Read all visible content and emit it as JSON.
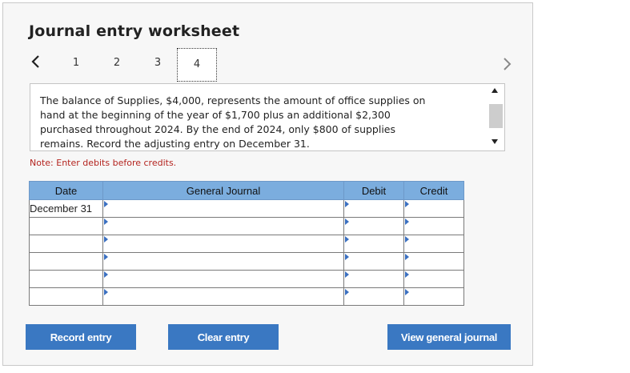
{
  "title": "Journal entry worksheet",
  "steps": [
    "1",
    "2",
    "3",
    "4"
  ],
  "active_step": "4",
  "prompt": "The balance of Supplies, $4,000, represents the amount of office supplies on hand at the beginning of the year of $1,700 plus an additional $2,300 purchased throughout 2024. By the end of 2024, only $800 of supplies remains. Record the adjusting entry on December 31.",
  "prompt_lines": [
    "The balance of Supplies, $4,000, represents the amount of office supplies on",
    "hand at the beginning of the year of $1,700 plus an additional $2,300",
    "purchased throughout 2024. By the end of 2024, only $800 of supplies",
    "remains. Record the adjusting entry on December 31."
  ],
  "note": "Note: Enter debits before credits.",
  "table": {
    "headers": {
      "date": "Date",
      "general_journal": "General Journal",
      "debit": "Debit",
      "credit": "Credit"
    },
    "rows": [
      {
        "date": "December 31"
      },
      {
        "date": ""
      },
      {
        "date": ""
      },
      {
        "date": ""
      },
      {
        "date": ""
      },
      {
        "date": ""
      }
    ]
  },
  "buttons": {
    "record": "Record entry",
    "clear": "Clear entry",
    "view": "View general journal"
  },
  "colors": {
    "header": "#7badde",
    "button": "#3a78c2",
    "note": "#b4241f"
  },
  "icons": {
    "prev": "chevron-left-icon",
    "next": "chevron-right-icon"
  }
}
